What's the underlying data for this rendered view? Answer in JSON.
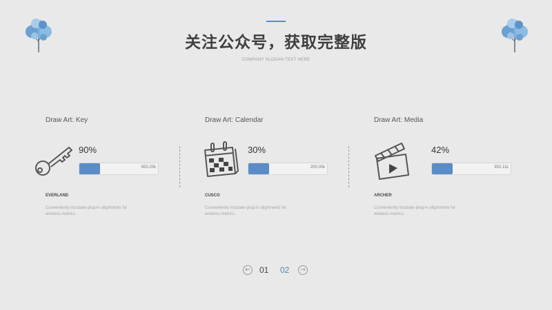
{
  "header": {
    "title": "关注公众号，获取完整版",
    "subtitle": "COMPANY SLOGAN TEXT HERE"
  },
  "cards": [
    {
      "title": "Draw Art: Key",
      "icon": "key-icon",
      "percent_label": "90%",
      "progress": 0.26,
      "bar_value": "650,20k",
      "company": "EVERLAND",
      "description": "Conveniently incubate plug-in alignments for wireless metrics."
    },
    {
      "title": "Draw Art: Calendar",
      "icon": "calendar-icon",
      "percent_label": "30%",
      "progress": 0.26,
      "bar_value": "200,00k",
      "company": "CUSCO",
      "description": "Conveniently incubate plug-in alignments for wireless metrics."
    },
    {
      "title": "Draw Art: Media",
      "icon": "clapperboard-icon",
      "percent_label": "42%",
      "progress": 0.26,
      "bar_value": "350,11k",
      "company": "ARCHER",
      "description": "Conveniently incubate plug-in alignments for wireless metrics."
    }
  ],
  "pager": {
    "prev_icon": "arrow-left-icon",
    "next_icon": "arrow-right-icon",
    "pages": [
      "01",
      "02"
    ],
    "current": "02"
  },
  "colors": {
    "accent": "#5b8cc8",
    "background": "#e9e9e9",
    "current_page": "#4a8aa8"
  }
}
